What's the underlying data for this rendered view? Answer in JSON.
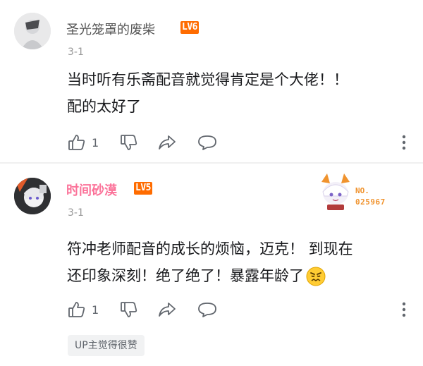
{
  "comments": [
    {
      "username": "圣光笼罩的废柴",
      "level": "LV6",
      "date": "3-1",
      "text": "当时听有乐斋配音就觉得肯定是个大佬！！\n配的太好了",
      "like_count": "1"
    },
    {
      "username": "时间砂漠",
      "level": "LV5",
      "date": "3-1",
      "text": "符冲老师配音的成长的烦恼，迈克！ 到现在\n还印象深刻！绝了绝了！暴露年龄了",
      "like_count": "1",
      "badge_label": "NO.",
      "badge_number": "025967",
      "up_tag": "UP主觉得很赞"
    }
  ],
  "colors": {
    "vip_name": "#fb7299",
    "level_badge": "#ff6c00",
    "icon": "#61666d",
    "meta": "#999999"
  }
}
